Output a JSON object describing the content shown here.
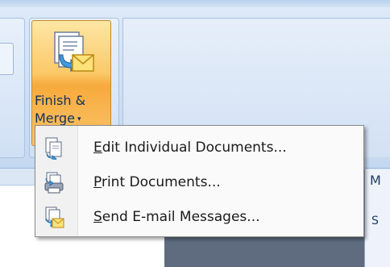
{
  "finish_merge": {
    "label_line1": "Finish &",
    "label_line2": "Merge",
    "dropdown_caret": "▾",
    "icon": "finish-merge-icon"
  },
  "menu": {
    "items": [
      {
        "accel": "E",
        "rest": "dit Individual Documents...",
        "icon": "edit-documents-icon"
      },
      {
        "accel": "P",
        "rest": "rint Documents...",
        "icon": "print-documents-icon"
      },
      {
        "accel": "S",
        "rest": "end E-mail Messages...",
        "icon": "email-messages-icon"
      }
    ]
  },
  "side_panel": {
    "letter_top": "M",
    "letter_mid": "S"
  },
  "colors": {
    "ribbon": "#cfdff3",
    "button_highlight": "#fcc968",
    "menu_bg": "#fafafa"
  }
}
